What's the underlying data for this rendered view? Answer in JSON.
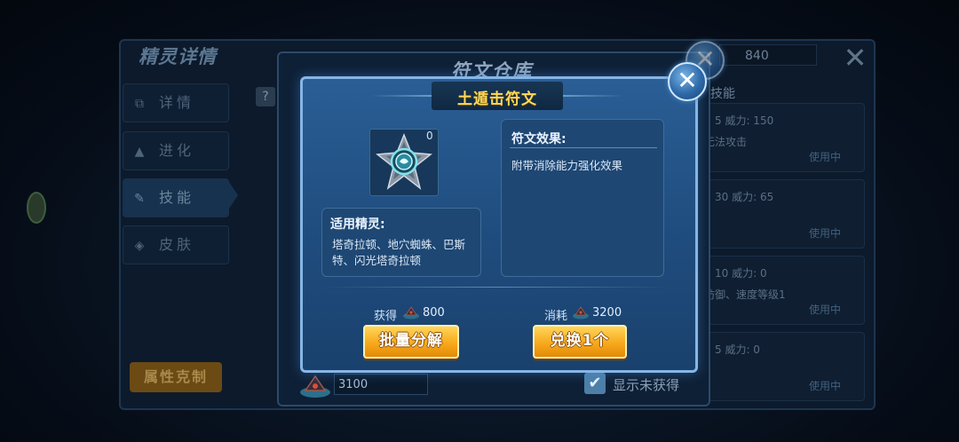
{
  "background": {
    "detail_title": "精灵详情",
    "tabs": [
      {
        "icon": "detail-icon",
        "glyph": "⧉",
        "label": "详情"
      },
      {
        "icon": "evolve-icon",
        "glyph": "▲",
        "label": "进化"
      },
      {
        "icon": "skill-icon",
        "glyph": "✎",
        "label": "技能"
      },
      {
        "icon": "skin-icon",
        "glyph": "◈",
        "label": "皮肤"
      }
    ],
    "attr_button": "属性克制",
    "help": "?",
    "currency_count": "840",
    "skill_header": "技能",
    "skills": [
      {
        "power": "5   威力: 150",
        "desc": "无法攻击",
        "status": "使用中"
      },
      {
        "power": "30   威力: 65",
        "desc": "",
        "status": "使用中"
      },
      {
        "power": "10   威力: 0",
        "desc": "防御、速度等级1",
        "status": "使用中"
      },
      {
        "power": "5   威力: 0",
        "desc": "",
        "status": "使用中"
      }
    ]
  },
  "warehouse": {
    "title": "符文仓库",
    "owned_count": "3100",
    "show_unobtained_label": "显示未获得",
    "show_unobtained_checked": true
  },
  "popup": {
    "title": "土遁击符文",
    "rune_icon": "shield-rune-icon",
    "rune_count": "0",
    "applicable_title": "适用精灵:",
    "applicable_text": "塔奇拉顿、地穴蜘蛛、巴斯特、闪光塔奇拉顿",
    "effect_title": "符文效果:",
    "effect_text": "附带消除能力强化效果",
    "gain_label": "获得",
    "gain_value": "800",
    "cost_label": "消耗",
    "cost_value": "3200",
    "decompose_button": "批量分解",
    "exchange_button": "兑换1个"
  },
  "colors": {
    "popup_bg": "#2a5e95",
    "popup_border": "#86b6e6",
    "title_gold": "#ffd95a",
    "button_gold": "#f7a91c"
  }
}
